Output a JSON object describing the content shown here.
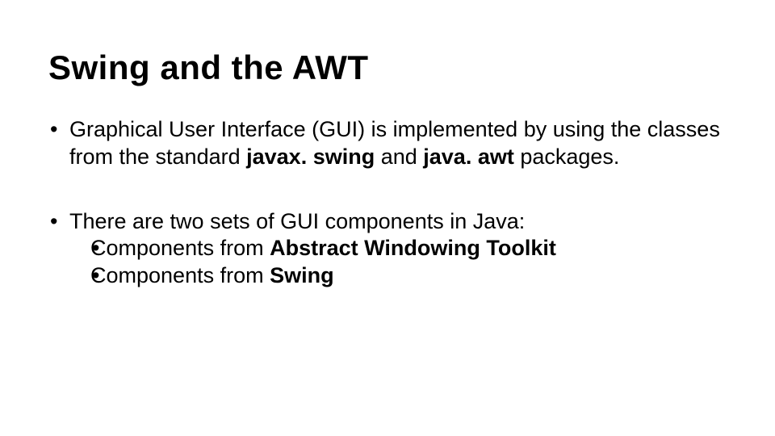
{
  "title": "Swing and the AWT",
  "b1_part1": "Graphical User Interface (GUI) is implemented by using the classes from the standard ",
  "b1_bold1": "javax. swing ",
  "b1_part2": "and ",
  "b1_bold2": "java. awt ",
  "b1_part3": "packages.",
  "b2_text": "There are two sets of GUI components in Java:",
  "b2a_part1": "Components from ",
  "b2a_bold": "Abstract Windowing Toolkit",
  "b2b_part1": "Components from ",
  "b2b_bold": "Swing"
}
